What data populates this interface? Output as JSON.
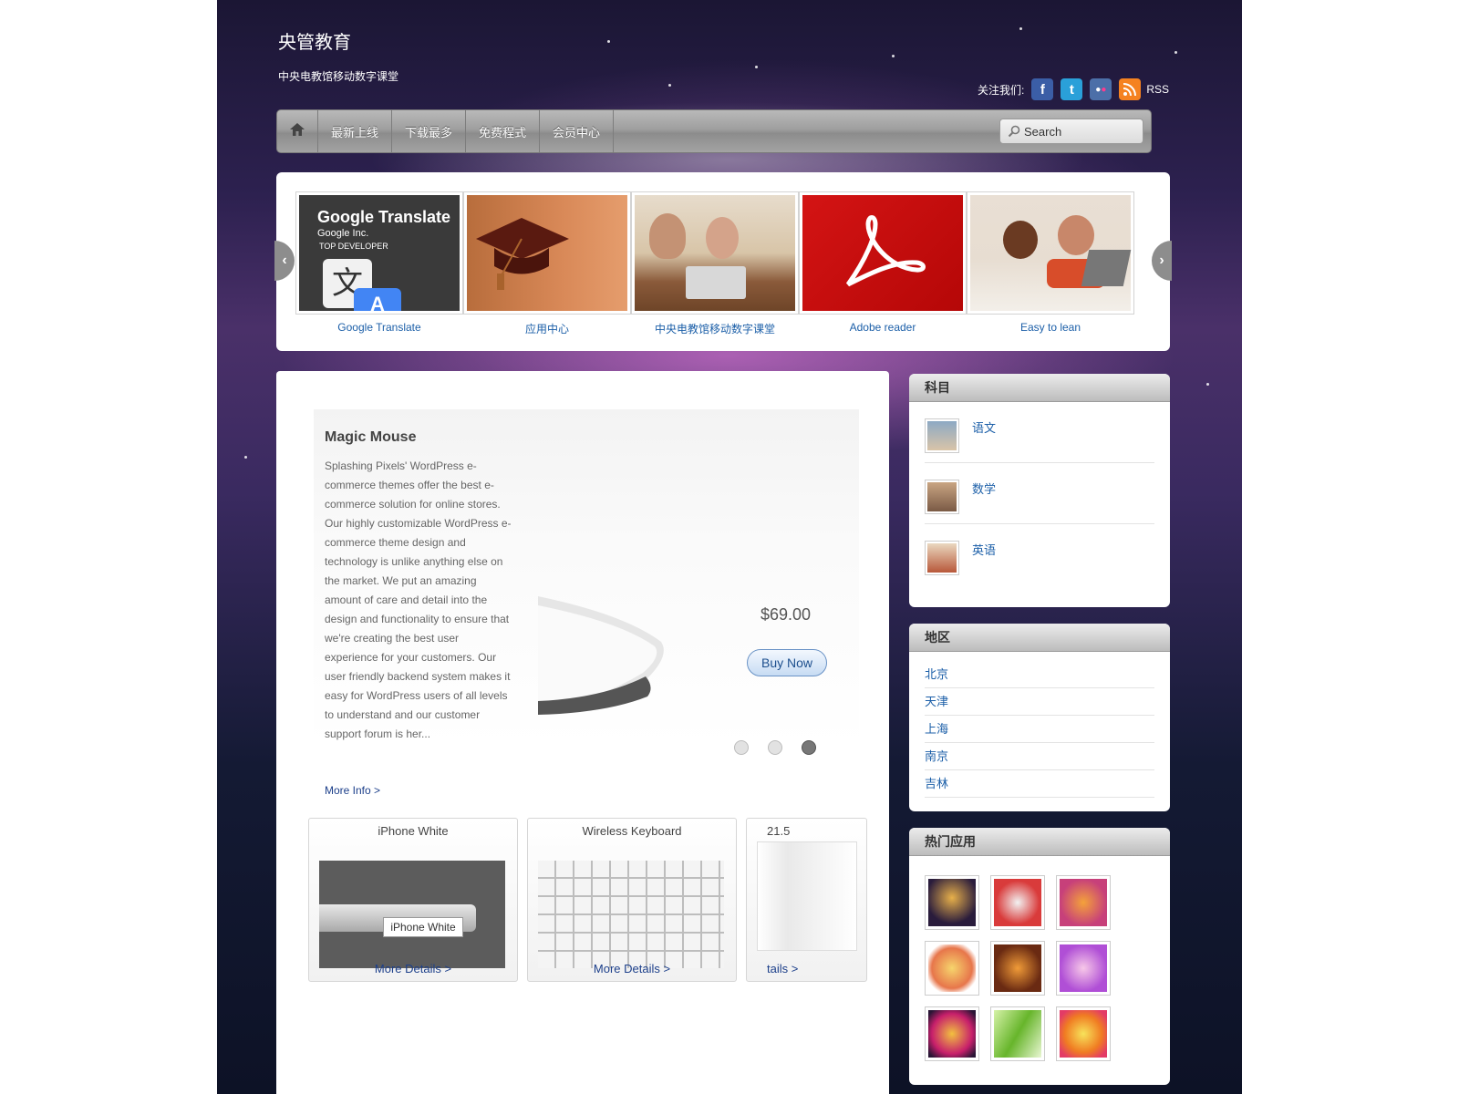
{
  "header": {
    "site_title": "央管教育",
    "site_desc": "中央电教馆移动数字课堂",
    "follow_label": "关注我们:",
    "rss_label": "RSS",
    "social_icons": [
      "facebook-icon",
      "twitter-icon",
      "flickr-icon",
      "rss-icon"
    ]
  },
  "nav": {
    "home_icon": "home-icon",
    "items": [
      "最新上线",
      "下载最多",
      "免费程式",
      "会员中心"
    ],
    "search_placeholder": "Search"
  },
  "carousel": {
    "items": [
      {
        "caption": "Google Translate",
        "title_text": "Google Translate",
        "sub1": "Google Inc.",
        "sub2": "TOP DEVELOPER",
        "glyph": "文",
        "glyph2": "A"
      },
      {
        "caption": "应用中心"
      },
      {
        "caption": "中央电教馆移动数字课堂"
      },
      {
        "caption": "Adobe reader"
      },
      {
        "caption": "Easy to lean"
      }
    ]
  },
  "slider": {
    "title": "Magic Mouse",
    "text": "Splashing Pixels' WordPress e-commerce themes offer the best e-commerce solution for online stores. Our highly customizable WordPress e-commerce theme design and technology is unlike anything else on the market. We put an amazing amount of care and detail into the design and functionality to ensure that we're creating the best user experience for your customers. Our user friendly backend system makes it easy for WordPress users of all levels to understand and our customer support forum is her...",
    "price": "$69.00",
    "buy_label": "Buy Now",
    "more_info": "More Info >",
    "active_dot": 3
  },
  "products": [
    {
      "name": "iPhone White",
      "details": "More Details >",
      "overlay": "iPhone White"
    },
    {
      "name": "Wireless Keyboard",
      "details": "More Details >"
    },
    {
      "name": "21.5",
      "details": "tails >"
    }
  ],
  "sidebar": {
    "subjects_title": "科目",
    "subjects": [
      "语文",
      "数学",
      "英语"
    ],
    "regions_title": "地区",
    "regions": [
      "北京",
      "天津",
      "上海",
      "南京",
      "吉林"
    ],
    "apps_title": "热门应用"
  },
  "colors": {
    "link": "#1c5fa8",
    "nav": "#9f9f9f",
    "page_bg": "#2d2150"
  }
}
